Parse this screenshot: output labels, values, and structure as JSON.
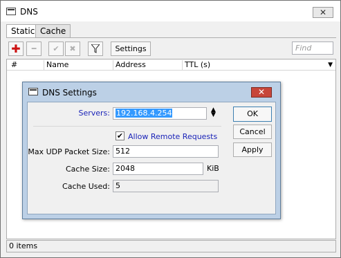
{
  "window": {
    "title": "DNS",
    "close_glyph": "✕"
  },
  "tabs": [
    {
      "label": "Static"
    },
    {
      "label": "Cache"
    }
  ],
  "toolbar": {
    "settings_label": "Settings",
    "find_placeholder": "Find",
    "add_icon": "plus-icon",
    "remove_icon": "minus-icon",
    "enable_icon": "check-icon",
    "disable_icon": "cross-icon",
    "filter_icon": "filter-icon",
    "add_color": "#cc1111"
  },
  "table": {
    "columns": [
      "#",
      "Name",
      "Address",
      "TTL (s)"
    ]
  },
  "status": {
    "items_text": "0 items"
  },
  "dialog": {
    "title": "DNS Settings",
    "close_glyph": "✕",
    "servers_label": "Servers:",
    "servers_value": "192.168.4.254",
    "allow_remote_label": "Allow Remote Requests",
    "allow_remote_checked": true,
    "max_udp_label": "Max UDP Packet Size:",
    "max_udp_value": "512",
    "cache_size_label": "Cache Size:",
    "cache_size_value": "2048",
    "cache_size_unit": "KiB",
    "cache_used_label": "Cache Used:",
    "cache_used_value": "5",
    "ok_label": "OK",
    "cancel_label": "Cancel",
    "apply_label": "Apply",
    "label_color": "#1a23b8"
  }
}
